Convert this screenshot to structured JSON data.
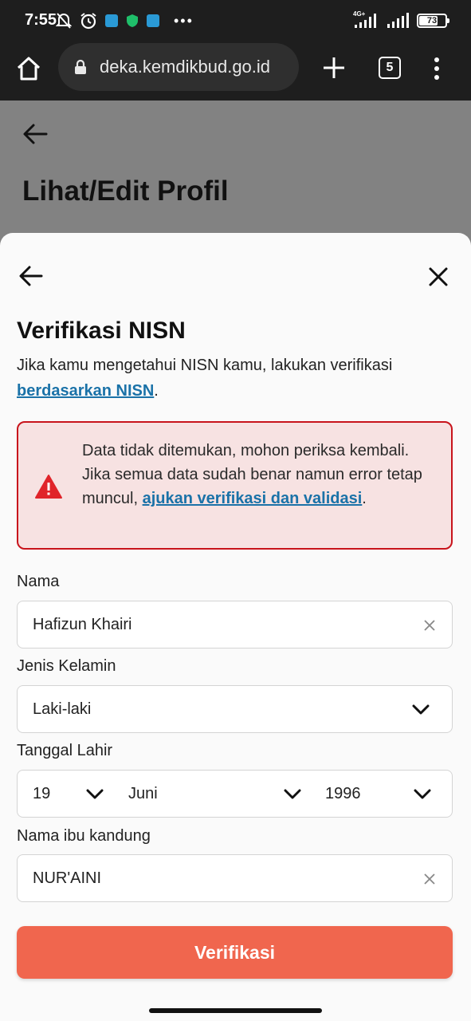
{
  "status_bar": {
    "time": "7:55",
    "dots": "•••",
    "network_label": "4G+",
    "battery_level": "73",
    "battery_fraction": 0.73,
    "icons": [
      "mute-bell-icon",
      "alarm-icon",
      "telegram-icon",
      "shield-icon",
      "facebook-icon",
      "signal-icon",
      "battery-icon"
    ]
  },
  "browser": {
    "url": "deka.kemdikbud.go.id",
    "tab_count": "5"
  },
  "background_page": {
    "title": "Lihat/Edit Profil"
  },
  "sheet": {
    "title": "Verifikasi NISN",
    "desc_text": "Jika kamu mengetahui NISN kamu, lakukan verifikasi ",
    "desc_link": "berdasarkan NISN",
    "desc_end": ".",
    "alert": {
      "text": "Data tidak ditemukan, mohon periksa kembali. Jika semua data sudah benar namun error tetap muncul, ",
      "link": "ajukan verifikasi dan validasi",
      "end": "."
    },
    "fields": {
      "name_label": "Nama",
      "name_value": "Hafizun Khairi",
      "gender_label": "Jenis Kelamin",
      "gender_value": "Laki-laki",
      "dob_label": "Tanggal Lahir",
      "dob_day": "19",
      "dob_month": "Juni",
      "dob_year": "1996",
      "mother_label": "Nama ibu kandung",
      "mother_value": "NUR'AINI"
    },
    "submit_label": "Verifikasi"
  },
  "colors": {
    "primary_button": "#f0664e",
    "link": "#1a72a8",
    "alert_border": "#c8141c",
    "alert_bg": "#f7e2e2"
  }
}
